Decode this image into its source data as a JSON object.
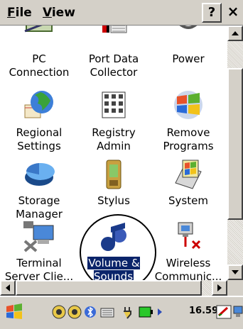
{
  "menubar": {
    "file_label": "File",
    "file_mnemonic": "F",
    "file_rest": "ile",
    "view_label": "View",
    "view_mnemonic": "V",
    "view_rest": "iew",
    "help_label": "?",
    "close_label": "×"
  },
  "items": [
    {
      "label": "PC\nConnection",
      "icon": "pc-connection-icon"
    },
    {
      "label": "Port Data\nCollector",
      "icon": "port-data-collector-icon"
    },
    {
      "label": "Power",
      "icon": "power-icon"
    },
    {
      "label": "Regional\nSettings",
      "icon": "globe-icon"
    },
    {
      "label": "Registry\nAdmin",
      "icon": "registry-icon"
    },
    {
      "label": "Remove\nPrograms",
      "icon": "windows-logo-icon"
    },
    {
      "label": "Storage\nManager",
      "icon": "pie-chart-icon"
    },
    {
      "label": "Stylus",
      "icon": "pda-icon"
    },
    {
      "label": "System",
      "icon": "system-icon"
    },
    {
      "label": "Terminal\nServer Clie...",
      "icon": "terminal-server-icon"
    },
    {
      "label": "Volume &\nSounds",
      "icon": "music-note-icon",
      "selected": true
    },
    {
      "label": "Wireless\nCommunic...",
      "icon": "wireless-icon"
    }
  ],
  "taskbar": {
    "clock": "16.59",
    "tray_icons": [
      "start-flag-icon",
      "network-icon",
      "network-icon",
      "bluetooth-icon",
      "keyboard-icon",
      "power-plug-icon",
      "battery-icon",
      "arrow-icon",
      "pen-icon",
      "display-icon"
    ]
  },
  "colors": {
    "chrome": "#d4d0c8",
    "selection": "#0a246a"
  }
}
